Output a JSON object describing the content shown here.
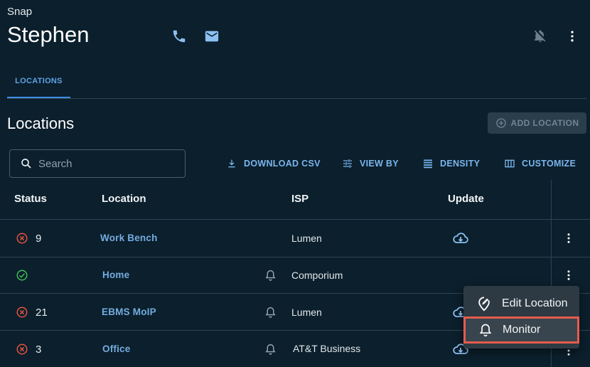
{
  "header": {
    "app_name": "Snap",
    "contact_name": "Stephen",
    "icons": [
      "phone-icon",
      "mail-icon",
      "notifications-off-icon",
      "more-vert-icon"
    ]
  },
  "tabs": [
    {
      "label": "LOCATIONS",
      "active": true
    }
  ],
  "section": {
    "title": "Locations",
    "add_button": "ADD LOCATION"
  },
  "toolbar": {
    "search_placeholder": "Search",
    "download_csv": "DOWNLOAD CSV",
    "view_by": "VIEW BY",
    "density": "DENSITY",
    "customize": "CUSTOMIZE"
  },
  "table": {
    "headers": {
      "status": "Status",
      "location": "Location",
      "isp": "ISP",
      "update": "Update"
    },
    "rows": [
      {
        "status": "error",
        "count": "9",
        "location": "Work Bench",
        "bell": false,
        "isp": "Lumen",
        "update_icon": true
      },
      {
        "status": "ok",
        "count": "",
        "location": "Home",
        "bell": true,
        "isp": "Comporium",
        "update_icon": false
      },
      {
        "status": "error",
        "count": "21",
        "location": "EBMS MoIP",
        "bell": true,
        "isp": "Lumen",
        "update_icon": true
      },
      {
        "status": "error",
        "count": "3",
        "location": "Office",
        "bell": true,
        "isp": "AT&T Business",
        "update_icon": true
      }
    ]
  },
  "context_menu": {
    "items": [
      {
        "label": "Edit Location",
        "icon": "edit-location-icon"
      },
      {
        "label": "Monitor",
        "icon": "bell-icon",
        "highlighted": true
      }
    ]
  },
  "colors": {
    "background": "#0b1f2c",
    "accent": "#3d8fe0",
    "error": "#e5533f",
    "ok": "#3fbf5a",
    "highlight_border": "#e55b4d"
  }
}
